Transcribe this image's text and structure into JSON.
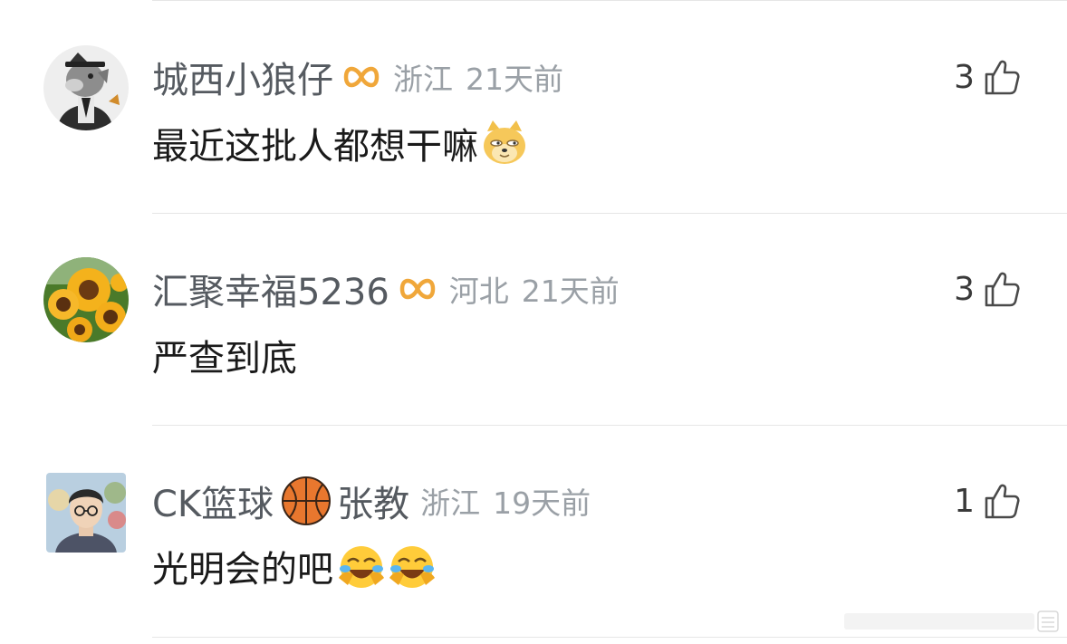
{
  "comments": [
    {
      "username": "城西小狼仔",
      "location": "浙江",
      "time": "21天前",
      "text": "最近这批人都想干嘛",
      "likes": "3",
      "avatar_icon": "wolf-avatar-icon",
      "emoji": "doge-emoji-icon"
    },
    {
      "username": "汇聚幸福5236",
      "location": "河北",
      "time": "21天前",
      "text": "严查到底",
      "likes": "3",
      "avatar_icon": "sunflower-avatar-icon"
    },
    {
      "username_part1": "CK篮球",
      "username_part2": "张教",
      "location": "浙江",
      "time": "19天前",
      "text": "光明会的吧",
      "likes": "1",
      "avatar_icon": "boy-photo-avatar-icon",
      "emoji": "laugh-cry-emoji-icon"
    }
  ],
  "colors": {
    "username": "#555a60",
    "meta": "#9aa0a6",
    "vip_badge": "#f0a73a",
    "divider": "#e6e6e6"
  }
}
